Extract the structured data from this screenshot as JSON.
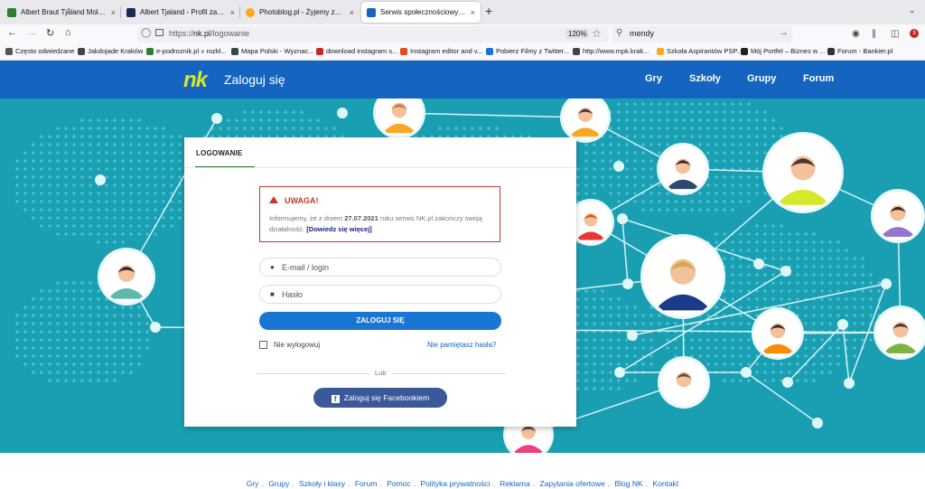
{
  "browser": {
    "tabs": [
      {
        "title": "Albert Braut Tjåland Molde FK",
        "favicon_color": "#2e7d32"
      },
      {
        "title": "Albert Tjaland - Profil zawodnik",
        "favicon_color": "#1a2b4c"
      },
      {
        "title": "Photoblog.pl - Żyjemy zdjęciam",
        "favicon_color": "#f9a825"
      },
      {
        "title": "Serwis społecznościowy nk.pl -",
        "favicon_color": "#1565c0"
      }
    ],
    "new_tab": "+",
    "tab_close": "×",
    "url_prefix": "https://",
    "url_host": "nk.pl",
    "url_path": "/logowanie",
    "zoom": "120%",
    "search_query": "mendy",
    "notifications_badge": "3"
  },
  "bookmarks": [
    {
      "label": "Często odwiedzane",
      "color": "#555555"
    },
    {
      "label": "Jakdojade Kraków",
      "color": "#444444"
    },
    {
      "label": "e-podroznik.pl » rozkł...",
      "color": "#2e7d32"
    },
    {
      "label": "Mapa Polski - Wyznac...",
      "color": "#37474f"
    },
    {
      "label": "download instagram s...",
      "color": "#c62828"
    },
    {
      "label": "Instagram editor and v...",
      "color": "#e64a19"
    },
    {
      "label": "Pobierz Filmy z Twitter...",
      "color": "#1976d2"
    },
    {
      "label": "http://www.mpk.krak...",
      "color": "#444444"
    },
    {
      "label": "Szkoła Aspirantów PSP...",
      "color": "#f9a825"
    },
    {
      "label": "Mój Portfel – Biznes w ...",
      "color": "#212121"
    },
    {
      "label": "Forum - Bankier.pl",
      "color": "#333333"
    }
  ],
  "site": {
    "logo": "nk",
    "header_title": "Zaloguj się",
    "nav": [
      "Gry",
      "Szkoły",
      "Grupy",
      "Forum"
    ],
    "colors": {
      "header": "#1565c0",
      "hero": "#1a9fb2",
      "accent": "#d5e82c",
      "button": "#1976d2",
      "facebook": "#3b5998",
      "alert": "#c0392b"
    }
  },
  "login": {
    "tab_label": "LOGOWANIE",
    "alert_title": "UWAGA!",
    "alert_text_1": "Informujemy, że z dniem ",
    "alert_date": "27.07.2021",
    "alert_text_2": " roku serwis NK.pl zakończy swoją działalność. ",
    "alert_link": "[Dowiedz się więcej]",
    "email_placeholder": "E-mail / login",
    "password_placeholder": "Hasło",
    "login_button": "ZALOGUJ SIĘ",
    "remember_label": "Nie wylogowuj",
    "forgot_link": "Nie pamiętasz hasła?",
    "or_label": "Lub",
    "facebook_button": "Zaloguj się Facebookiem"
  },
  "footer": {
    "links": [
      "Gry",
      "Grupy",
      "Szkoły i klasy",
      "Forum",
      "Pomoc",
      "Polityka prywatności",
      "Reklama",
      "Zapytania ofertowe",
      "Blog NK",
      "Kontakt"
    ]
  }
}
